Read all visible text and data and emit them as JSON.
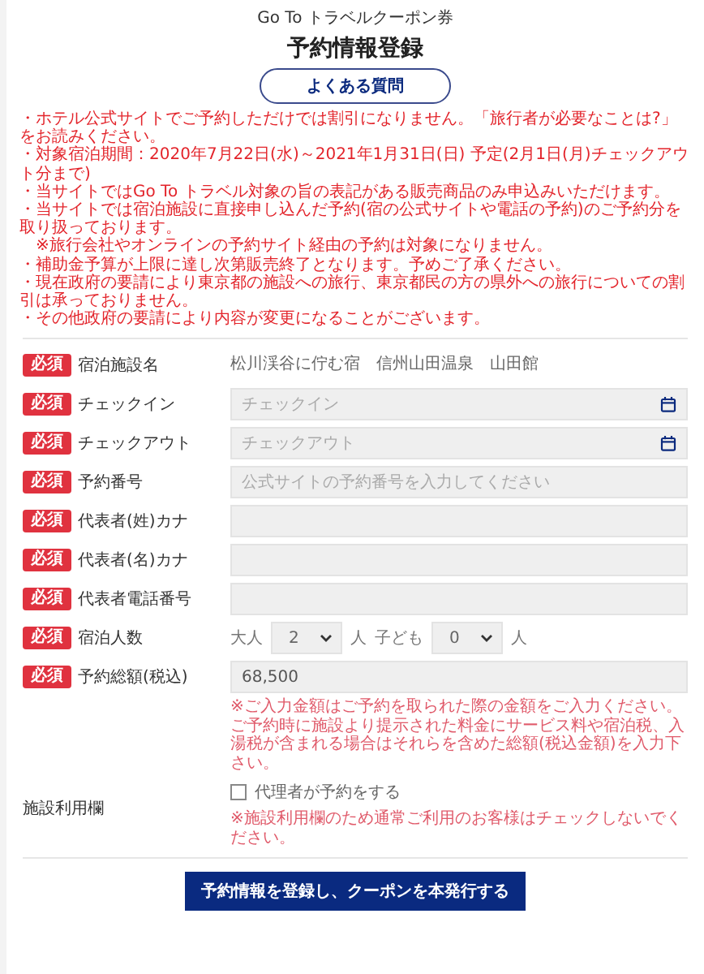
{
  "header": {
    "subtitle": "Go To トラベルクーポン券",
    "title": "予約情報登録",
    "faq_button": "よくある質問"
  },
  "notices": [
    {
      "text": "・ホテル公式サイトでご予約しただけでは割引になりません。「旅行者が必要なことは?」をお読みください。",
      "indented": false
    },
    {
      "text": "・対象宿泊期間：2020年7月22日(水)～2021年1月31日(日) 予定(2月1日(月)チェックアウト分まで)",
      "indented": false
    },
    {
      "text": "・当サイトではGo To トラベル対象の旨の表記がある販売商品のみ申込みいただけます。",
      "indented": false
    },
    {
      "text": "・当サイトでは宿泊施設に直接申し込んだ予約(宿の公式サイトや電話の予約)のご予約分を取り扱っております。",
      "indented": false
    },
    {
      "text": "※旅行会社やオンラインの予約サイト経由の予約は対象になりません。",
      "indented": true
    },
    {
      "text": "・補助金予算が上限に達し次第販売終了となります。予めご了承ください。",
      "indented": false
    },
    {
      "text": "・現在政府の要請により東京都の施設への旅行、東京都民の方の県外への旅行についての割引は承っておりません。",
      "indented": false
    },
    {
      "text": "・その他政府の要請により内容が変更になることがございます。",
      "indented": false
    }
  ],
  "form": [
    {
      "kind": "text",
      "badge": "必須",
      "required": true,
      "label": "宿泊施設名",
      "value": "松川渓谷に佇む宿　信州山田温泉　山田館"
    },
    {
      "kind": "date",
      "badge": "必須",
      "required": true,
      "label": "チェックイン",
      "placeholder": "チェックイン"
    },
    {
      "kind": "date",
      "badge": "必須",
      "required": true,
      "label": "チェックアウト",
      "placeholder": "チェックアウト"
    },
    {
      "kind": "input",
      "badge": "必須",
      "required": true,
      "label": "予約番号",
      "placeholder": "公式サイトの予約番号を入力してください"
    },
    {
      "kind": "input",
      "badge": "必須",
      "required": true,
      "label": "代表者(姓)カナ"
    },
    {
      "kind": "input",
      "badge": "必須",
      "required": true,
      "label": "代表者(名)カナ"
    },
    {
      "kind": "input",
      "badge": "必須",
      "required": true,
      "label": "代表者電話番号"
    },
    {
      "kind": "guests",
      "badge": "必須",
      "required": true,
      "label": "宿泊人数",
      "adults_label": "大人",
      "adults": "2",
      "adults_unit": "人",
      "children_label": "子ども",
      "children": "0",
      "children_unit": "人"
    },
    {
      "kind": "input",
      "badge": "必須",
      "required": true,
      "label": "予約総額(税込)",
      "value": "68,500",
      "note": "※ご入力金額はご予約を取られた際の金額をご入力ください。ご予約時に施設より提示された料金にサービス料や宿泊税、入湯税が含まれる場合はそれらを含めた総額(税込金額)を入力下さい。"
    },
    {
      "kind": "checkbox",
      "required": false,
      "label": "施設利用欄",
      "checkbox_label": "代理者が予約をする",
      "checked": false,
      "note": "※施設利用欄のため通常ご利用のお客様はチェックしないでください。"
    }
  ],
  "submit_button": "予約情報を登録し、クーポンを本発行する"
}
